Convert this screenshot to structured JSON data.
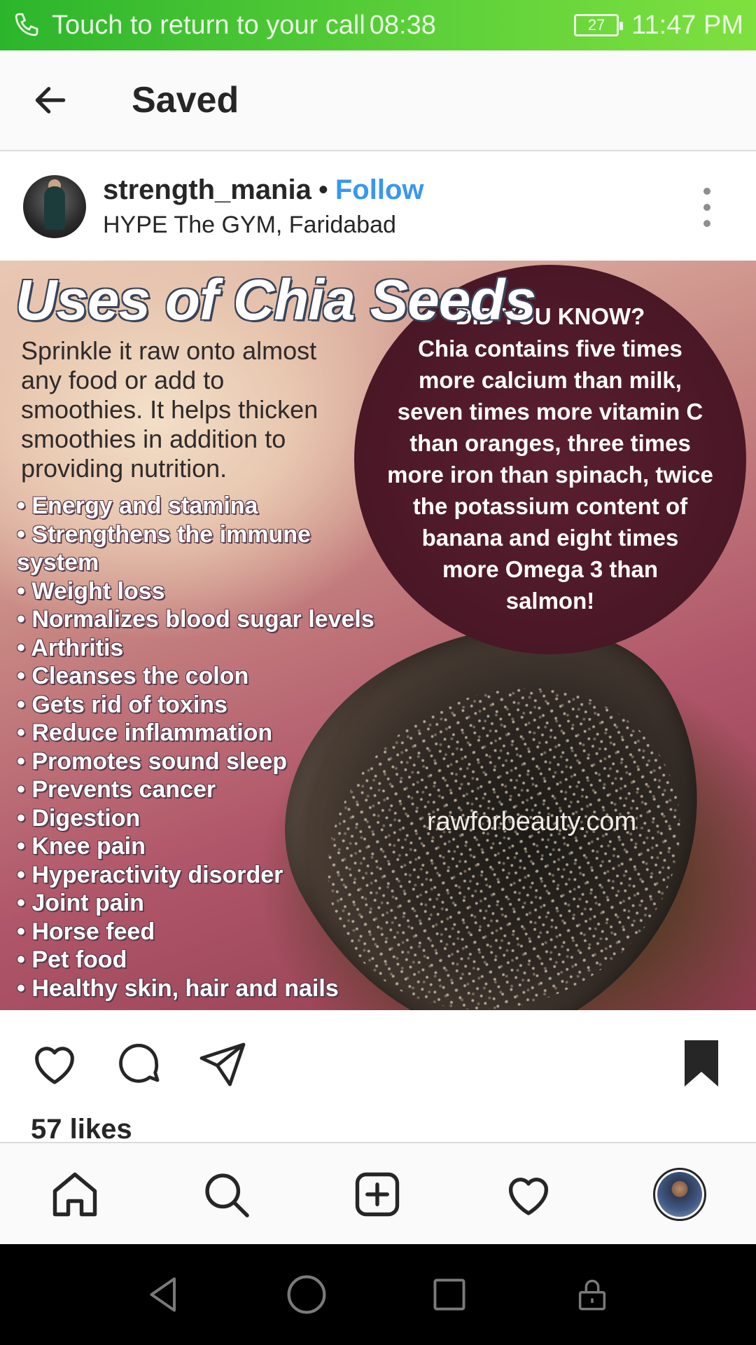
{
  "status_bar": {
    "call_text": "Touch to return to your call",
    "call_timer": "08:38",
    "battery_level": "27",
    "time": "11:47 PM"
  },
  "header": {
    "title": "Saved"
  },
  "post": {
    "username": "strength_mania",
    "separator": "•",
    "follow_label": "Follow",
    "location": "HYPE The GYM, Faridabad",
    "image": {
      "title": "Uses of Chia Seeds",
      "intro": "Sprinkle it raw onto almost\nany food or add to\nsmoothies. It helps thicken\nsmoothies in addition to\nproviding nutrition.",
      "uses": [
        "Energy and stamina",
        "Strengthens the immune\n   system",
        "Weight loss",
        "Normalizes blood sugar levels",
        "Arthritis",
        "Cleanses the colon",
        "Gets rid of toxins",
        "Reduce inflammation",
        "Promotes sound sleep",
        "Prevents cancer",
        "Digestion",
        "Knee pain",
        "Hyperactivity disorder",
        "Joint pain",
        "Horse feed",
        "Pet food",
        "Healthy skin, hair and nails"
      ],
      "did_you_know_title": "DID YOU KNOW?",
      "did_you_know_body": "Chia contains five times\nmore calcium than milk,\nseven times more vitamin C\nthan oranges, three times\nmore iron than spinach, twice\nthe potassium content of\nbanana and eight times\nmore Omega 3 than\nsalmon!",
      "watermark": "rawforbeauty.com"
    },
    "likes": "57 likes"
  },
  "icons": {
    "like": "heart-icon",
    "comment": "comment-icon",
    "share": "send-icon",
    "save": "bookmark-filled-icon"
  },
  "bottom_nav": {
    "items": [
      "home-icon",
      "search-icon",
      "add-post-icon",
      "activity-heart-icon",
      "profile-avatar"
    ]
  },
  "colors": {
    "status_bar_green": "#3fc232",
    "follow_blue": "#3897f0",
    "text_primary": "#262626",
    "circle_maroon": "#4a1727"
  }
}
